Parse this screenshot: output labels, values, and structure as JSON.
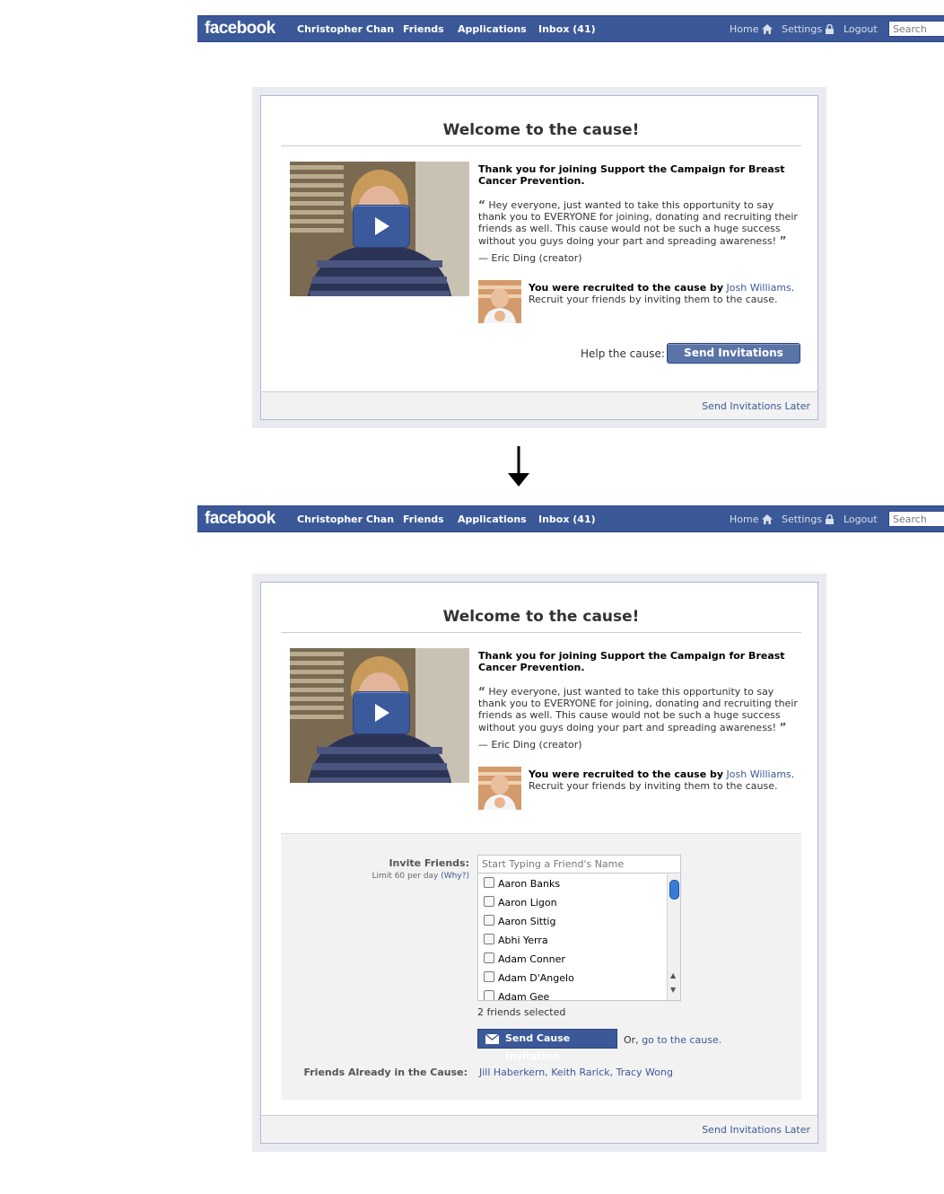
{
  "header": {
    "logo": "facebook",
    "nav": {
      "user": "Christopher Chan",
      "friends": "Friends",
      "applications": "Applications",
      "inbox": "Inbox (41)"
    },
    "right": {
      "home": "Home",
      "settings": "Settings",
      "logout": "Logout"
    },
    "search_placeholder": "Search"
  },
  "dialog": {
    "title": "Welcome to the cause!",
    "thanks": "Thank you for joining Support the Campaign for Breast Cancer Prevention.",
    "quote": "Hey everyone, just wanted to take this opportunity to say thank you to EVERYONE for joining, donating and recruiting their friends as well. This cause would not be such a huge success without you guys doing your part and spreading awareness!",
    "creator": "— Eric Ding (creator)",
    "recruit_lead": "You were recruited to the cause by",
    "recruiter": "Josh Williams",
    "recruit_tail": "Recruit your friends by inviting them to the cause.",
    "help_label": "Help the cause:",
    "send_button": "Send Invitations",
    "later_link": "Send Invitations Later"
  },
  "invite": {
    "label": "Invite Friends:",
    "limit": "Limit 60 per day",
    "why": "(Why?)",
    "input_placeholder": "Start Typing a Friend's Name",
    "friends": [
      "Aaron Banks",
      "Aaron Ligon",
      "Aaron Sittig",
      "Abhi Yerra",
      "Adam Conner",
      "Adam D'Angelo",
      "Adam Gee"
    ],
    "selected_count": "2 friends selected",
    "send_button": "Send Cause Invitation",
    "or_text": "Or,",
    "go_link": "go to the cause.",
    "already_label": "Friends Already in the Cause:",
    "already_list": "Jill Haberkern, Keith Rarick, Tracy Wong"
  },
  "colors": {
    "brand_blue": "#3b5998",
    "dialog_border": "#b0b9cf",
    "link": "#3b5998"
  },
  "icons": [
    "home-icon",
    "lock-icon",
    "play-icon",
    "envelope-icon",
    "down-arrow-icon"
  ]
}
